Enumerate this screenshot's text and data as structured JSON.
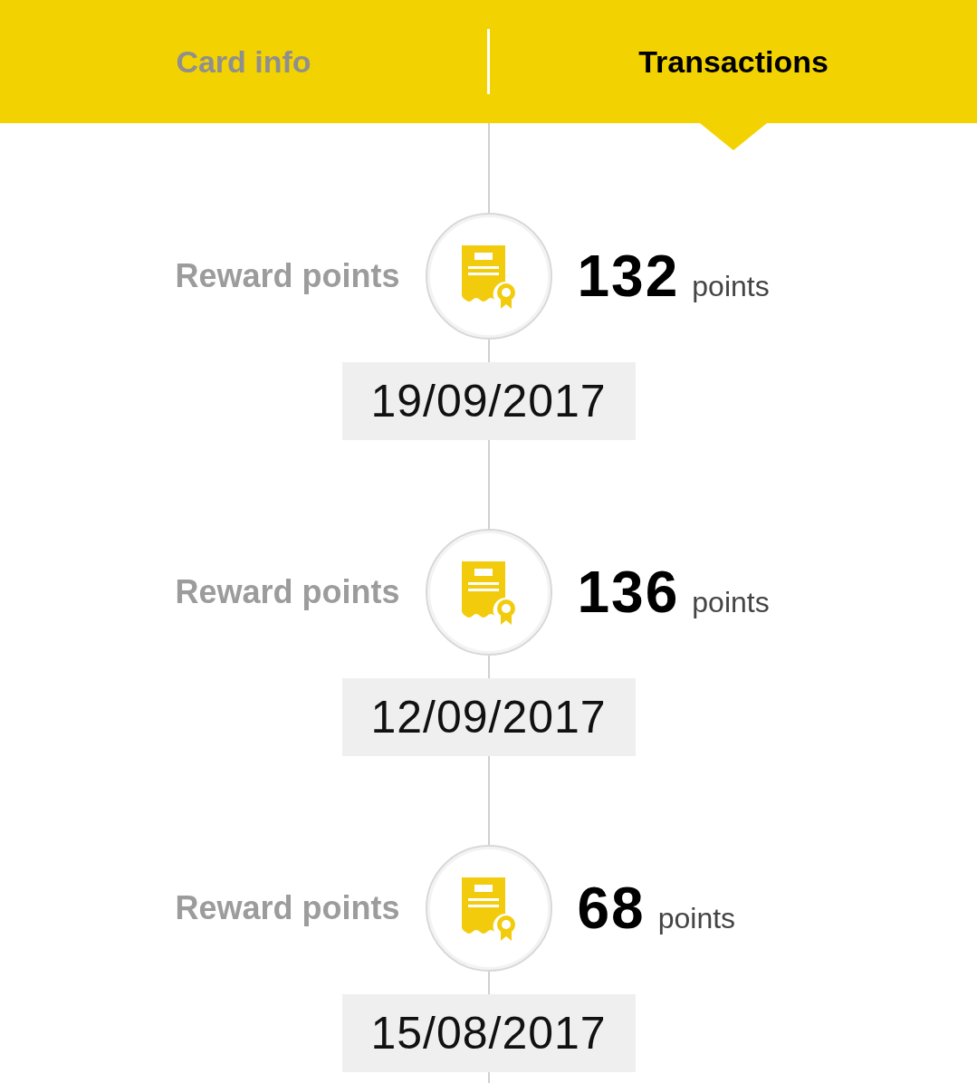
{
  "tabs": [
    {
      "label": "Card info",
      "selected": false
    },
    {
      "label": "Transactions",
      "selected": true
    }
  ],
  "transactions": [
    {
      "label": "Reward points",
      "amount": "132",
      "unit": "points",
      "date": "19/09/2017"
    },
    {
      "label": "Reward points",
      "amount": "136",
      "unit": "points",
      "date": "12/09/2017"
    },
    {
      "label": "Reward points",
      "amount": "68",
      "unit": "points",
      "date": "15/08/2017"
    }
  ]
}
